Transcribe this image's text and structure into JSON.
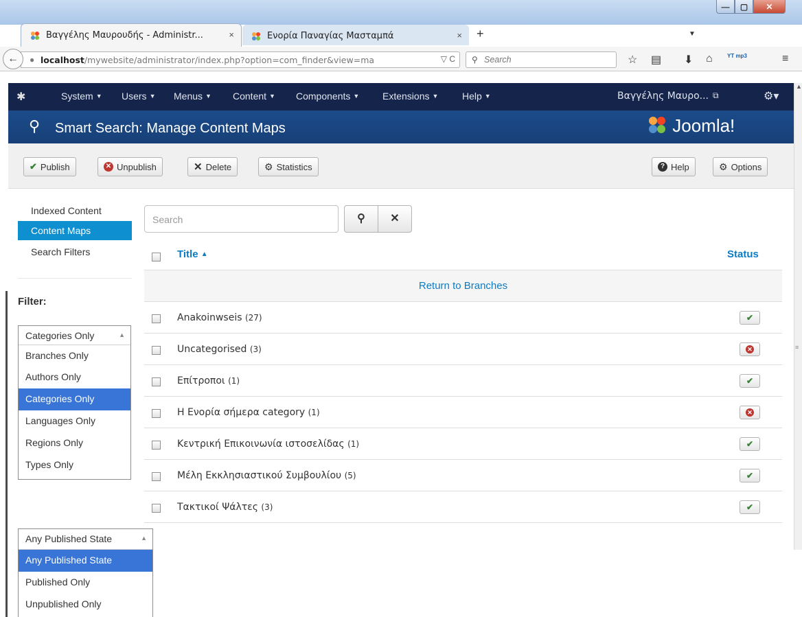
{
  "browser": {
    "tabs": [
      {
        "title": "Βαγγέλης Μαυρουδής - Administr...",
        "close": "×"
      },
      {
        "title": "Ενορία Παναγίας Μασταμπά",
        "close": "×"
      }
    ],
    "new_tab": "+",
    "url_host": "localhost",
    "url_path": "/mywebsite/administrator/index.php?option=com_finder&view=ma",
    "search_placeholder": "Search",
    "yt_icon_label": "YT mp3"
  },
  "joomla_nav": {
    "menus": [
      "System",
      "Users",
      "Menus",
      "Content",
      "Components",
      "Extensions",
      "Help"
    ],
    "user": "Βαγγέλης Μαυρο..."
  },
  "header": {
    "title": "Smart Search: Manage Content Maps",
    "logo_text": "Joomla!"
  },
  "toolbar": {
    "publish": "Publish",
    "unpublish": "Unpublish",
    "delete": "Delete",
    "statistics": "Statistics",
    "help": "Help",
    "options": "Options"
  },
  "sidebar": {
    "items": [
      {
        "label": "Indexed Content",
        "active": false
      },
      {
        "label": "Content Maps",
        "active": true
      },
      {
        "label": "Search Filters",
        "active": false
      }
    ],
    "filter_heading": "Filter:",
    "type_filter": {
      "selected": "Categories Only",
      "options": [
        "Branches Only",
        "Authors Only",
        "Categories Only",
        "Languages Only",
        "Regions Only",
        "Types Only"
      ]
    },
    "state_filter": {
      "selected": "Any Published State",
      "options": [
        "Any Published State",
        "Published Only",
        "Unpublished Only"
      ]
    }
  },
  "main": {
    "search_placeholder": "Search",
    "columns": {
      "title": "Title",
      "status": "Status"
    },
    "return_link": "Return to Branches",
    "rows": [
      {
        "title": "Anakoinwseis",
        "count": "(27)",
        "published": true
      },
      {
        "title": "Uncategorised",
        "count": "(3)",
        "published": false
      },
      {
        "title": "Επίτροποι",
        "count": "(1)",
        "published": true
      },
      {
        "title": "Η Ενορία σήμερα category",
        "count": "(1)",
        "published": false
      },
      {
        "title": "Κεντρική Επικοινωνία ιστοσελίδας",
        "count": "(1)",
        "published": true
      },
      {
        "title": "Μέλη Εκκλησιαστικού Συμβουλίου",
        "count": "(5)",
        "published": true
      },
      {
        "title": "Τακτικοί Ψάλτες",
        "count": "(3)",
        "published": true
      }
    ]
  },
  "colors": {
    "nav_bg": "#15244a",
    "header_bg": "#1c4b8a",
    "link": "#0b7cc4",
    "active_sidebar": "#0d8fd0",
    "published": "#378137",
    "unpublished": "#bd362f"
  }
}
